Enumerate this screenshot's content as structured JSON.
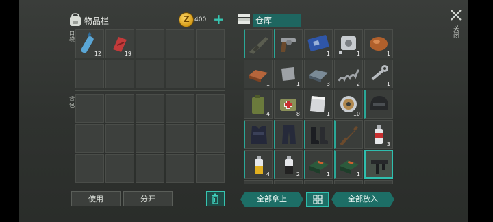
{
  "inventory": {
    "title": "物品栏",
    "pocket_label": "口袋",
    "backpack_label": "背包",
    "items": [
      {
        "icon": "water-bottle-icon",
        "qty": "12"
      },
      {
        "icon": "red-cloth-icon",
        "qty": "19"
      }
    ]
  },
  "currency": {
    "amount": "400",
    "add_label": "+"
  },
  "warehouse": {
    "title": "仓库",
    "items": [
      {
        "icon": "assault-rifle-icon",
        "qty": ""
      },
      {
        "icon": "revolver-icon",
        "qty": ""
      },
      {
        "icon": "circuit-board-icon",
        "qty": "1"
      },
      {
        "icon": "engine-part-icon",
        "qty": "1"
      },
      {
        "icon": "meat-icon",
        "qty": "1"
      },
      {
        "icon": "copper-ingot-icon",
        "qty": "1"
      },
      {
        "icon": "metal-plate-icon",
        "qty": "1"
      },
      {
        "icon": "steel-ingot-icon",
        "qty": "3"
      },
      {
        "icon": "spring-icon",
        "qty": "2"
      },
      {
        "icon": "wrench-icon",
        "qty": "1"
      },
      {
        "icon": "jerrycan-icon",
        "qty": "4"
      },
      {
        "icon": "first-aid-bag-icon",
        "qty": "8"
      },
      {
        "icon": "sheet-metal-icon",
        "qty": "1"
      },
      {
        "icon": "wire-spool-icon",
        "qty": "10"
      },
      {
        "icon": "helmet-icon",
        "qty": ""
      },
      {
        "icon": "armor-vest-icon",
        "qty": ""
      },
      {
        "icon": "tactical-pants-icon",
        "qty": ""
      },
      {
        "icon": "boots-icon",
        "qty": ""
      },
      {
        "icon": "ak-rifle-icon",
        "qty": ""
      },
      {
        "icon": "spray-can-red-icon",
        "qty": "3"
      },
      {
        "icon": "spray-can-yellow-icon",
        "qty": "4"
      },
      {
        "icon": "spray-can-black-icon",
        "qty": "2"
      },
      {
        "icon": "ammo-box-icon",
        "qty": "1"
      },
      {
        "icon": "ammo-box-icon",
        "qty": "1"
      },
      {
        "icon": "smg-icon",
        "qty": ""
      }
    ]
  },
  "buttons": {
    "use": "使用",
    "split": "分开",
    "take_all": "全部拿上",
    "put_all": "全部放入",
    "close": "关闭"
  },
  "colors": {
    "accent": "#2fbfae",
    "accent_dark": "#1d6e66",
    "coin": "#e0a81e"
  }
}
